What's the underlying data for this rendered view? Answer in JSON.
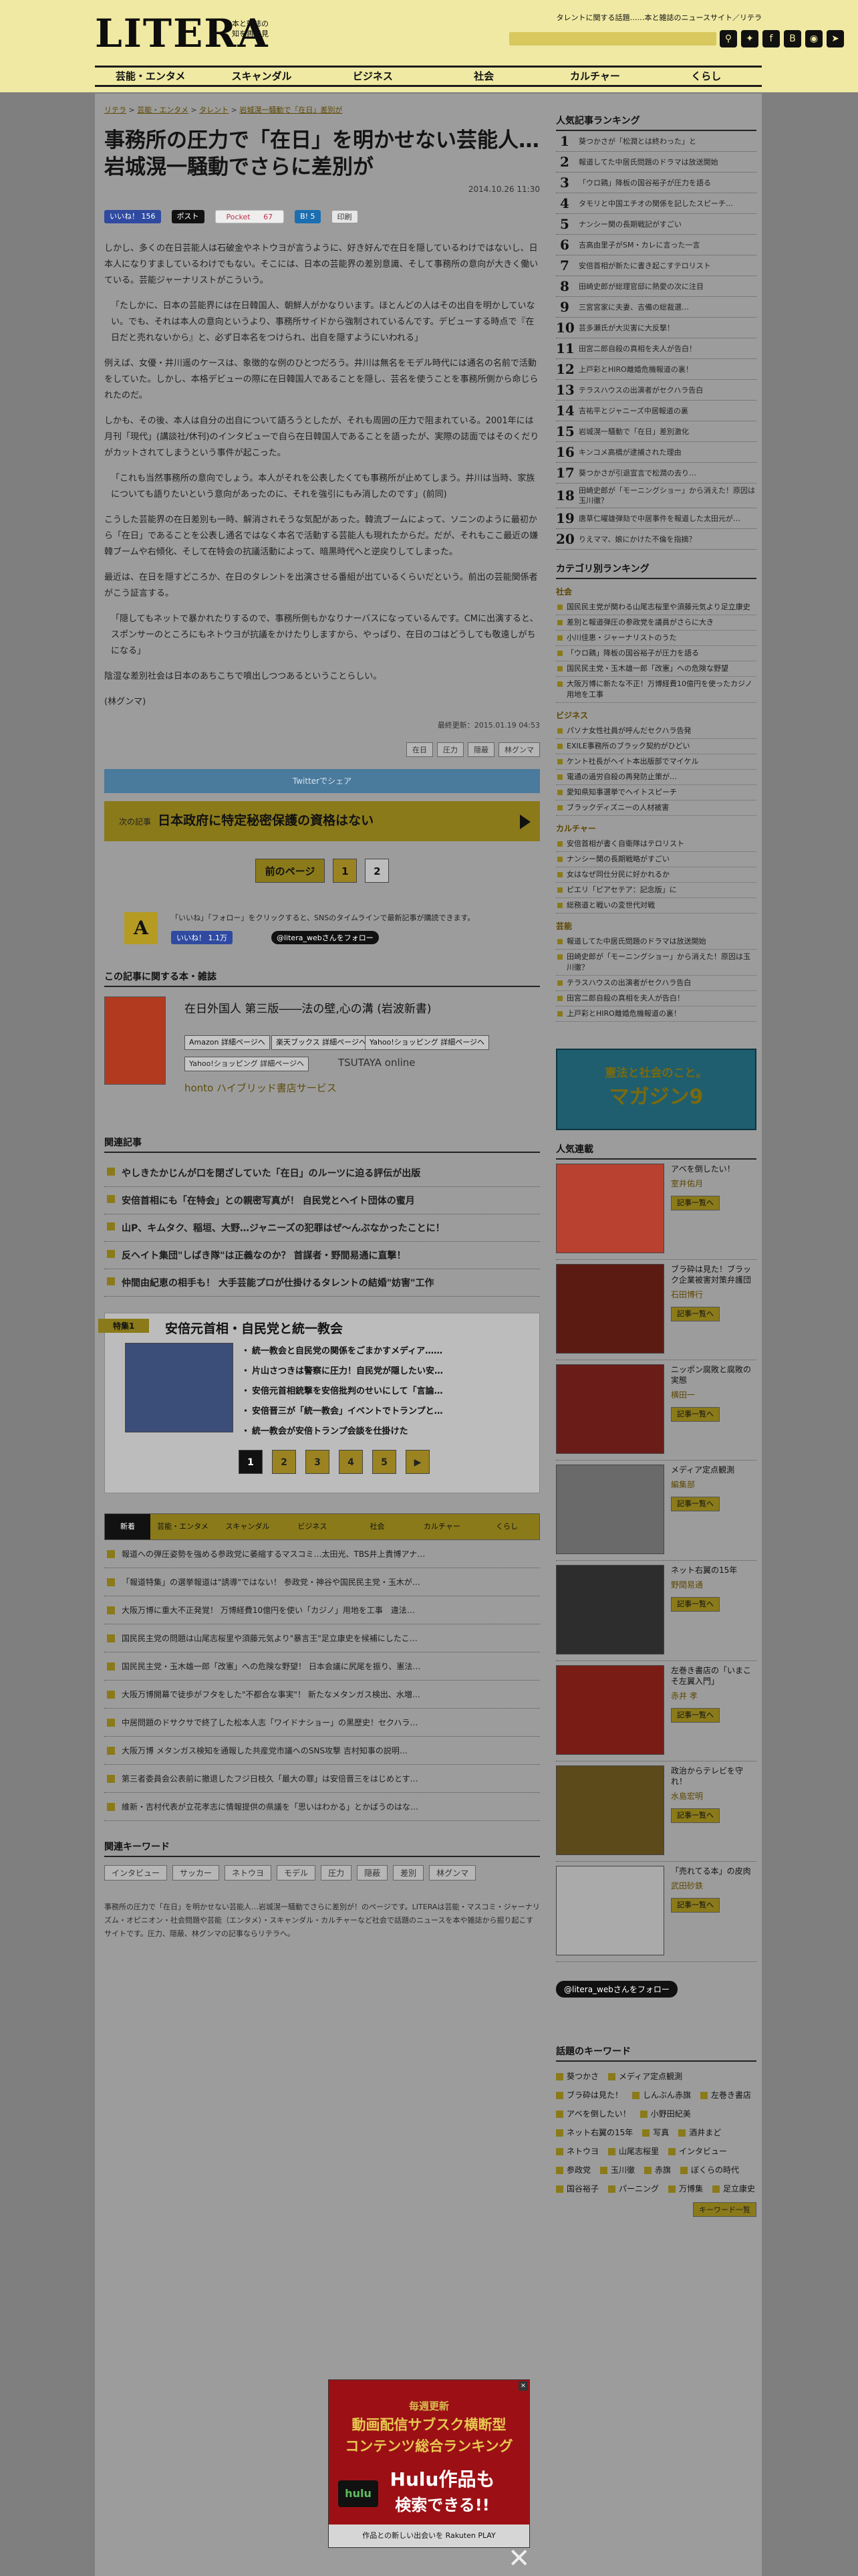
{
  "header": {
    "logo": "LITERA",
    "logo_sub_1": "本と雑誌の",
    "logo_sub_2": "知を再発見",
    "tagline": "タレントに関する話題……本と雑誌のニュースサイト／リテラ",
    "search_placeholder": ""
  },
  "nav": [
    "芸能・エンタメ",
    "スキャンダル",
    "ビジネス",
    "社会",
    "カルチャー",
    "くらし"
  ],
  "breadcrumb": [
    "リテラ",
    "芸能・エンタメ",
    "タレント",
    "岩城滉一騒動で「在日」差別が"
  ],
  "article": {
    "title": "事務所の圧力で「在日」を明かせない芸能人… 岩城滉一騒動でさらに差別が",
    "date": "2014.10.26 11:30",
    "share": {
      "fb": "いいね！ 156",
      "tw": "ポスト",
      "pocket": "Pocket",
      "pocket_count": "67",
      "hatena": "B! 5",
      "print": "印刷"
    },
    "paragraphs": [
      "しかし、多くの在日芸能人は石破金やネトウヨが言うように、好き好んで在日を隠しているわけではないし、日本人になりすましているわけでもない。そこには、日本の芸能界の差別意識、そして事務所の意向が大きく働いている。芸能ジャーナリストがこういう。",
      "「たしかに、日本の芸能界には在日韓国人、朝鮮人がかなりいます。ほとんどの人はその出自を明かしていない。でも、それは本人の意向というより、事務所サイドから強制されているんです。デビューする時点で『在日だと売れないから』と、必ず日本名をつけられ、出自を隠すようにいわれる」",
      "例えば、女優・井川遥のケースは、象徴的な例のひとつだろう。井川は無名をモデル時代には通名の名前で活動をしていた。しかし、本格デビューの際に在日韓国人であることを隠し、芸名を使うことを事務所側から命じられたのだ。",
      "しかも、その後、本人は自分の出自について語ろうとしたが、それも周囲の圧力で阻まれている。2001年には月刊「現代」(講談社/休刊)のインタビューで自ら在日韓国人であることを語ったが、実際の誌面ではそのくだりがカットされてしまうという事件が起こった。",
      "「これも当然事務所の意向でしょう。本人がそれを公表したくても事務所が止めてしまう。井川は当時、家族についても語りたいという意向があったのに、それを強引にもみ消したのです」(前同)",
      "こうした芸能界の在日差別も一時、解消されそうな気配があった。韓流ブームによって、ソニンのように最初から「在日」であることを公表し通名ではなく本名で活動する芸能人も現れたからだ。だが、それもここ最近の嫌韓ブームや右傾化、そして在特会の抗議活動によって、暗黒時代へと逆戻りしてしまった。",
      "最近は、在日を隠すどころか、在日のタレントを出演させる番組が出ているくらいだという。前出の芸能関係者がこう証言する。",
      "「隠してもネットで暴かれたりするので、事務所側もかなりナーバスになっているんです。CMに出演すると、スポンサーのところにもネトウヨが抗議をかけたりしますから、やっぱり、在日のコはどうしても敬遠しがちになる」",
      "陰湿な差別社会は日本のあちこちで噴出しつつあるということらしい。",
      "(林グンマ)"
    ],
    "updated": "最終更新：2015.01.19 04:53",
    "tags": [
      "在日",
      "圧力",
      "隠蔽",
      "林グンマ"
    ]
  },
  "twitter_share_bar": "Twitterでシェア",
  "next_article": {
    "label": "次の記事",
    "title": "日本政府に特定秘密保護の資格はない"
  },
  "pager": {
    "prev": "前のページ",
    "pages": [
      "1",
      "2"
    ]
  },
  "follow": {
    "text": "「いいね」「フォロー」をクリックすると、SNSのタイムラインで最新記事が購読できます。",
    "fb": "いいね！ 1.1万",
    "x": "@litera_webさんをフォロー"
  },
  "book_section": {
    "heading": "この記事に関する本・雑誌",
    "title": "在日外国人 第三版――法の壁,心の溝 (岩波新書)",
    "buttons": [
      "Amazon 詳細ページへ",
      "楽天ブックス 詳細ページへ",
      "Yahoo!ショッピング 詳細ページへ",
      "Yahoo!ショッピング 詳細ページへ"
    ],
    "tsutaya": "TSUTAYA online",
    "honto": "honto ハイブリッド書店サービス"
  },
  "related": {
    "heading": "関連記事",
    "items": [
      "やしきたかじんが口を閉ざしていた「在日」のルーツに迫る評伝が出版",
      "安倍首相にも「在特会」との親密写真が！ 自民党とヘイト団体の蜜月",
      "山P、キムタク、稲垣、大野…ジャニーズの犯罪はぜ～んぶなかったことに！",
      "反ヘイト集団\"しばき隊\"は正義なのか？ 首謀者・野間易通に直撃！",
      "仲間由紀恵の相手も！ 大手芸能プロが仕掛けるタレントの結婚\"妨害\"工作"
    ]
  },
  "feature": {
    "label": "特集1",
    "title": "安倍元首相・自民党と統一教会",
    "items": [
      "統一教会と自民党の関係をごまかすメディア……",
      "片山さつきは警察に圧力！自民党が隠したい安…",
      "安倍元首相銃撃を安倍批判のせいにして「言論…",
      "安倍晋三が「統一教会」イベントでトランプと…",
      "統一教会が安倍トランプ会談を仕掛けた"
    ],
    "pages": [
      "1",
      "2",
      "3",
      "4",
      "5",
      "▶"
    ]
  },
  "news_tabs": [
    "新着",
    "芸能・エンタメ",
    "スキャンダル",
    "ビジネス",
    "社会",
    "カルチャー",
    "くらし"
  ],
  "news": [
    "報道への弾圧姿勢を強める参政党に萎縮するマスコミ…太田光、TBS井上貴博アナ…",
    "「報道特集」の選挙報道は\"誘導\"ではない！ 参政党・神谷や国民民主党・玉木が…",
    "大阪万博に重大不正発覚！ 万博経費10億円を使い「カジノ」用地を工事　違法…",
    "国民民主党の問題は山尾志桜里や須藤元気より\"暴言王\"足立康史を候補にしたこ…",
    "国民民主党・玉木雄一郎「改憲」への危険な野望！ 日本会議に尻尾を振り、憲法…",
    "大阪万博開幕で徒歩がフタをした\"不都合な事実\"！ 新たなメタンガス検出、水増…",
    "中居問題のドサクサで終了した松本人志「ワイドナショー」の黒歴史！セクハラ…",
    "大阪万博 メタンガス検知を通報した共産党市議へのSNS攻撃 吉村知事の説明…",
    "第三者委員会公表前に撤退したフジ日枝久「最大の罪」は安倍晋三をはじめとす…",
    "維新・吉村代表が立花孝志に情報提供の県議を「思いはわかる」とかばうのはな…"
  ],
  "keywords": {
    "heading": "関連キーワード",
    "items": [
      "インタビュー",
      "サッカー",
      "ネトウヨ",
      "モデル",
      "圧力",
      "隠蔽",
      "差別",
      "林グンマ"
    ]
  },
  "footer_text": "事務所の圧力で「在日」を明かせない芸能人…岩城滉一騒動でさらに差別が！のページです。LITERAは芸能・マスコミ・ジャーナリズム・オピニオン・社会問題や芸能（エンタメ）・スキャンダル・カルチャーなど社会で話題のニュースを本や雑誌から掘り起こすサイトです。圧力、隠蔽、林グンマの記事ならリテラへ。",
  "sidebar": {
    "ranking_heading": "人気記事ランキング",
    "ranking": [
      "葵つかさが「松潤とは終わった」と",
      "報道してた中居氏問題のドラマは放送開始",
      "「ウロ鶏」降板の国谷裕子が圧力を語る",
      "タモリと中国エチオの関係を記したスピーチ…",
      "ナンシー関の長期戦記がすごい",
      "吉高由里子がSM・カレに言った一言",
      "安倍首相が新たに書き起こすテロリスト",
      "田崎史郎が総理官邸に熱愛の次に注目",
      "三宮宮家に夫妻、吉備の総裁選…",
      "芸多瀬氏が大災害に大反撃！",
      "田宮二郎自殺の真相を夫人が告白！",
      "上戸彩とHIRO離婚危機報道の裏！",
      "テラスハウスの出演者がセクハラ告白",
      "吉祐平とジャニーズ中居報道の裏",
      "岩城滉一騒動で「在日」差別激化",
      "キンコメ高橋が逮捕された理由",
      "葵つかさが引退宣言で松潤の去り…",
      "田崎史郎が「モーニングショー」から消えた！原因は玉川徹？",
      "唐草仁曜雄弾劾で中居事件を報道した太田元が…",
      "りえママ、娘にかけた不倫を指摘？"
    ],
    "cat_heading": "カテゴリ別ランキング",
    "categories": [
      {
        "name": "社会",
        "items": [
          "国民民主党が関わる山尾志桜里や須藤元気より足立康史",
          "差別と報道弾圧の参政党を議員がさらに大き",
          "小川佳恵・ジャーナリストのうた",
          "「ウロ鶏」降板の国谷裕子が圧力を語る",
          "国民民主党・玉木雄一郎「改憲」への危険な野望",
          "大阪万博に新たな不正！万博経費10億円を使ったカジノ用地を工事"
        ]
      },
      {
        "name": "ビジネス",
        "items": [
          "パソナ女性社員が呼んだセクハラ告発",
          "EXILE事務所のブラック契約がひどい",
          "ケント社長がヘイト本出版部でマイケル",
          "電通の過労自殺の再発防止策が…",
          "愛知県知事選挙でヘイトスピーチ",
          "ブラックディズニーの人材被害"
        ]
      },
      {
        "name": "カルチャー",
        "items": [
          "安倍首相が書く自衛隊はテロリスト",
          "ナンシー関の長期戦略がすごい",
          "女はなぜ同仕分民に好かれるか",
          "ピエリ「ピアセテア：記念版」に",
          "総務道と戦いの変世代対戦"
        ]
      },
      {
        "name": "芸能",
        "items": [
          "報道してた中居氏問題のドラマは放送開始",
          "田崎史郎が「モーニングショー」から消えた！原因は玉川徹？",
          "テラスハウスの出演者がセクハラ告白",
          "田宮二郎自殺の真相を夫人が告白！",
          "上戸彩とHIRO離婚危機報道の裏！"
        ]
      }
    ],
    "mag": {
      "line1": "憲法と社会のこと。",
      "line2": "マガジン9"
    },
    "popular_heading": "人気連載",
    "popular": [
      {
        "title": "アベを倒したい！",
        "author": "室井佑月",
        "more": "記事一覧へ",
        "color": "#b8412f"
      },
      {
        "title": "ブラ砕は見た！ブラック企業被害対策弁護団",
        "author": "石田博行",
        "more": "記事一覧へ",
        "color": "#5b1b12"
      },
      {
        "title": "ニッポン腐敗と腐敗の実態",
        "author": "横田一",
        "more": "記事一覧へ",
        "color": "#6a1d18"
      },
      {
        "title": "メディア定点観測",
        "author": "編集部",
        "more": "記事一覧へ",
        "color": "#6a6a6a"
      },
      {
        "title": "ネット右翼の15年",
        "author": "野間易通",
        "more": "記事一覧へ",
        "color": "#2d2d2d"
      },
      {
        "title": "左巻き書店の「いまこそ左翼入門」",
        "author": "赤井 孝",
        "more": "記事一覧へ",
        "color": "#7a1c16"
      },
      {
        "title": "政治からテレビを守れ！",
        "author": "水島宏明",
        "more": "記事一覧へ",
        "color": "#5c4a1a"
      },
      {
        "title": "「売れてる本」の皮肉",
        "author": "武田砂鉄",
        "more": "記事一覧へ",
        "color": "#aaaaaa"
      }
    ],
    "x_follow": "@litera_webさんをフォロー",
    "kw_heading": "話題のキーワード",
    "keywords": [
      "葵つかさ",
      "メディア定点観測",
      "ブラ砕は見た！",
      "しんぶん赤旗",
      "左巻き書店",
      "アベを倒したい！",
      "小野田紀美",
      "ネット右翼の15年",
      "写真",
      "酒井まど",
      "ネトウヨ",
      "山尾志桜里",
      "インタビュー",
      "参政党",
      "玉川徹",
      "赤旗",
      "ぼくらの時代",
      "国谷裕子",
      "パーニング",
      "万博集",
      "足立康史"
    ],
    "kw_more": "キーワード一覧"
  },
  "ad": {
    "line1": "毎週更新",
    "line2": "動画配信サブスク横断型",
    "line3": "コンテンツ総合ランキング",
    "line4": "Hulu作品も",
    "line5": "検索できる!!",
    "logo": "hulu",
    "footer": "作品との新しい出会いを Rakuten PLAY",
    "close": "✕"
  }
}
